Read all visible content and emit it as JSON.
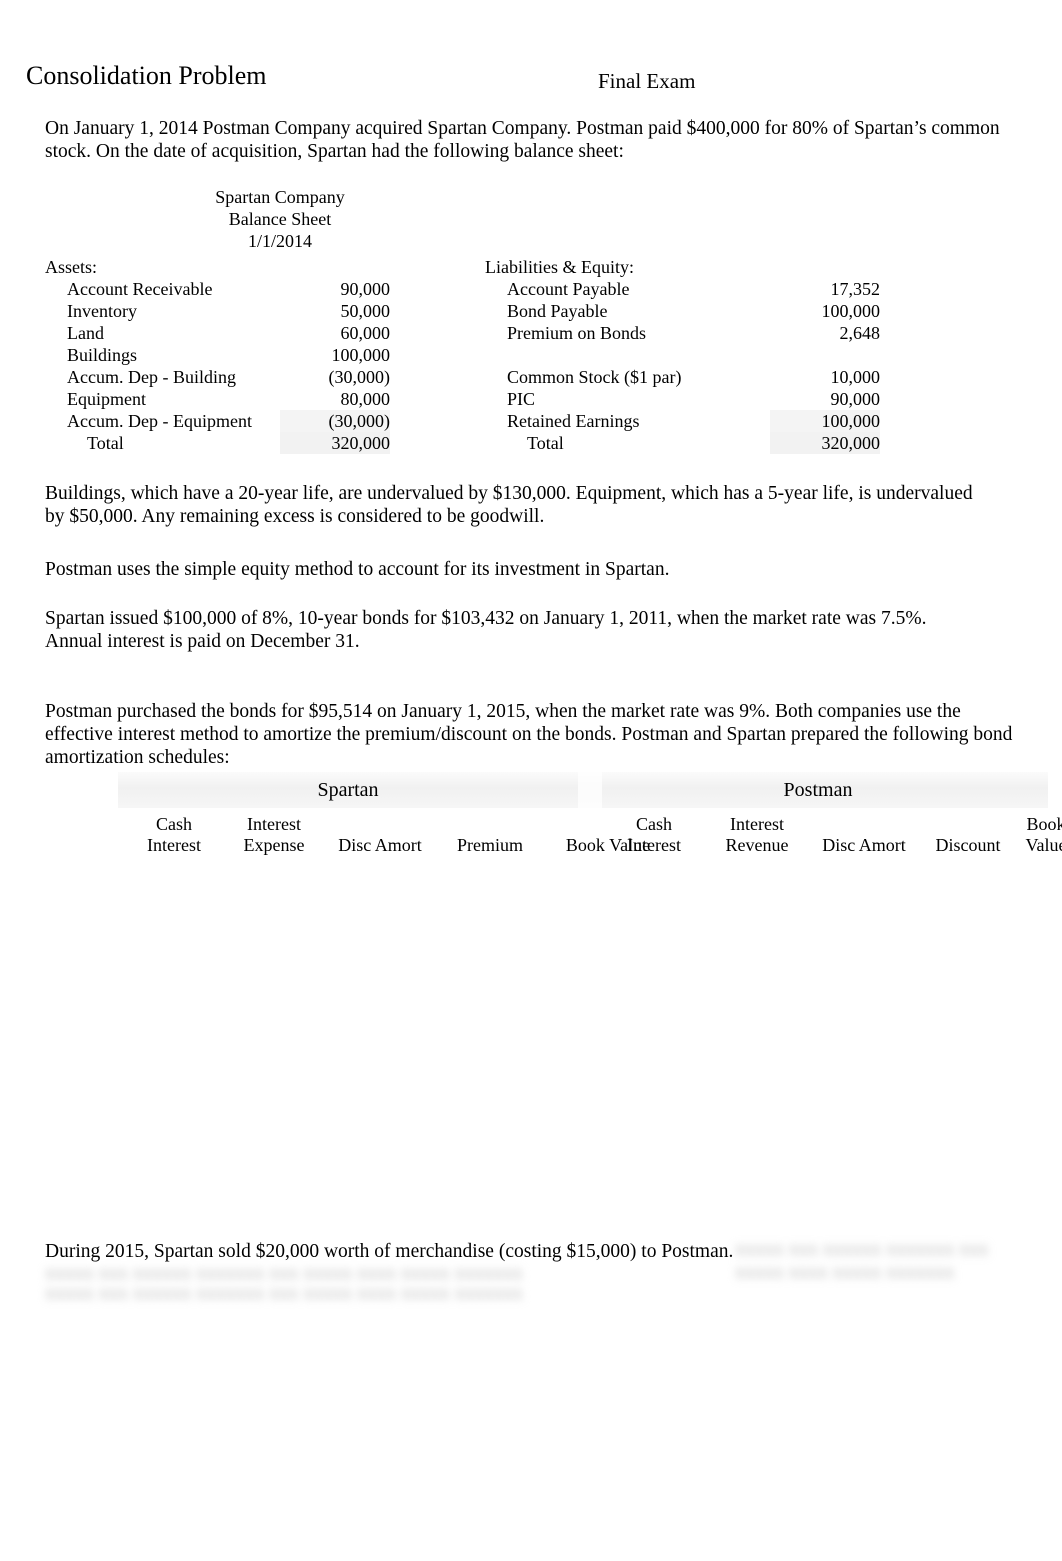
{
  "header": {
    "title": "Consolidation Problem",
    "exam_label": "Final Exam"
  },
  "paragraphs": {
    "intro": "On January 1, 2014 Postman Company acquired Spartan Company. Postman paid $400,000 for 80% of Spartan’s common stock. On the date of acquisition, Spartan had the following balance sheet:",
    "undervalued": "Buildings, which have a 20-year life, are undervalued by $130,000. Equipment, which has a 5-year life, is undervalued by $50,000. Any remaining excess is considered to be goodwill.",
    "equity_method": "Postman uses the simple equity method to account for its investment in Spartan.",
    "bond_issue": "Spartan issued $100,000 of 8%, 10-year bonds for $103,432 on January 1, 2011, when the market rate was 7.5%. Annual interest is paid on December 31.",
    "bond_purchase": "Postman purchased the bonds for $95,514 on January 1, 2015, when the market rate was 9%. Both companies use the effective interest method to amortize the premium/discount on the bonds. Postman and Spartan prepared the following bond amortization schedules:",
    "merchandise": "During 2015, Spartan sold $20,000 worth of merchandise (costing $15,000) to Postman.",
    "redacted_text": "xxxxx xxx xxxxxx xxxxxxx xxx xxxxx xxxx xxxxx xxxxxxx"
  },
  "balance_sheet": {
    "company": "Spartan Company",
    "statement": "Balance Sheet",
    "date": "1/1/2014",
    "assets_heading": "Assets:",
    "liabilities_heading": "Liabilities & Equity:",
    "total_label": "Total",
    "currency_symbol": "$",
    "assets": [
      {
        "label": "Account Receivable",
        "amount": "90,000"
      },
      {
        "label": "Inventory",
        "amount": "50,000"
      },
      {
        "label": "Land",
        "amount": "60,000"
      },
      {
        "label": "Buildings",
        "amount": "100,000"
      },
      {
        "label": "Accum. Dep - Building",
        "amount": "(30,000)"
      },
      {
        "label": "Equipment",
        "amount": "80,000"
      },
      {
        "label": "Accum. Dep - Equipment",
        "amount": "(30,000)"
      }
    ],
    "assets_total": "320,000",
    "liabilities": [
      {
        "label": "Account Payable",
        "amount": "17,352"
      },
      {
        "label": "Bond Payable",
        "amount": "100,000"
      },
      {
        "label": "Premium on Bonds",
        "amount": "2,648"
      },
      {
        "label": "",
        "amount": ""
      },
      {
        "label": "Common Stock ($1 par)",
        "amount": "10,000"
      },
      {
        "label": "PIC",
        "amount": "90,000"
      },
      {
        "label": "Retained Earnings",
        "amount": "100,000"
      }
    ],
    "liabilities_total": "320,000"
  },
  "amortization": {
    "spartan": {
      "company": "Spartan",
      "columns": [
        {
          "line1": "Cash",
          "line2": "Interest"
        },
        {
          "line1": "Interest",
          "line2": "Expense"
        },
        {
          "line1": "",
          "line2": "Disc Amort"
        },
        {
          "line1": "",
          "line2": "Premium"
        },
        {
          "line1": "",
          "line2": "Book Value"
        }
      ],
      "rows": []
    },
    "postman": {
      "company": "Postman",
      "columns": [
        {
          "line1": "Cash",
          "line2": "Interest"
        },
        {
          "line1": "Interest",
          "line2": "Revenue"
        },
        {
          "line1": "",
          "line2": "Disc Amort"
        },
        {
          "line1": "",
          "line2": "Discount"
        },
        {
          "line1": "Book",
          "line2": "Value"
        }
      ],
      "rows": []
    }
  }
}
